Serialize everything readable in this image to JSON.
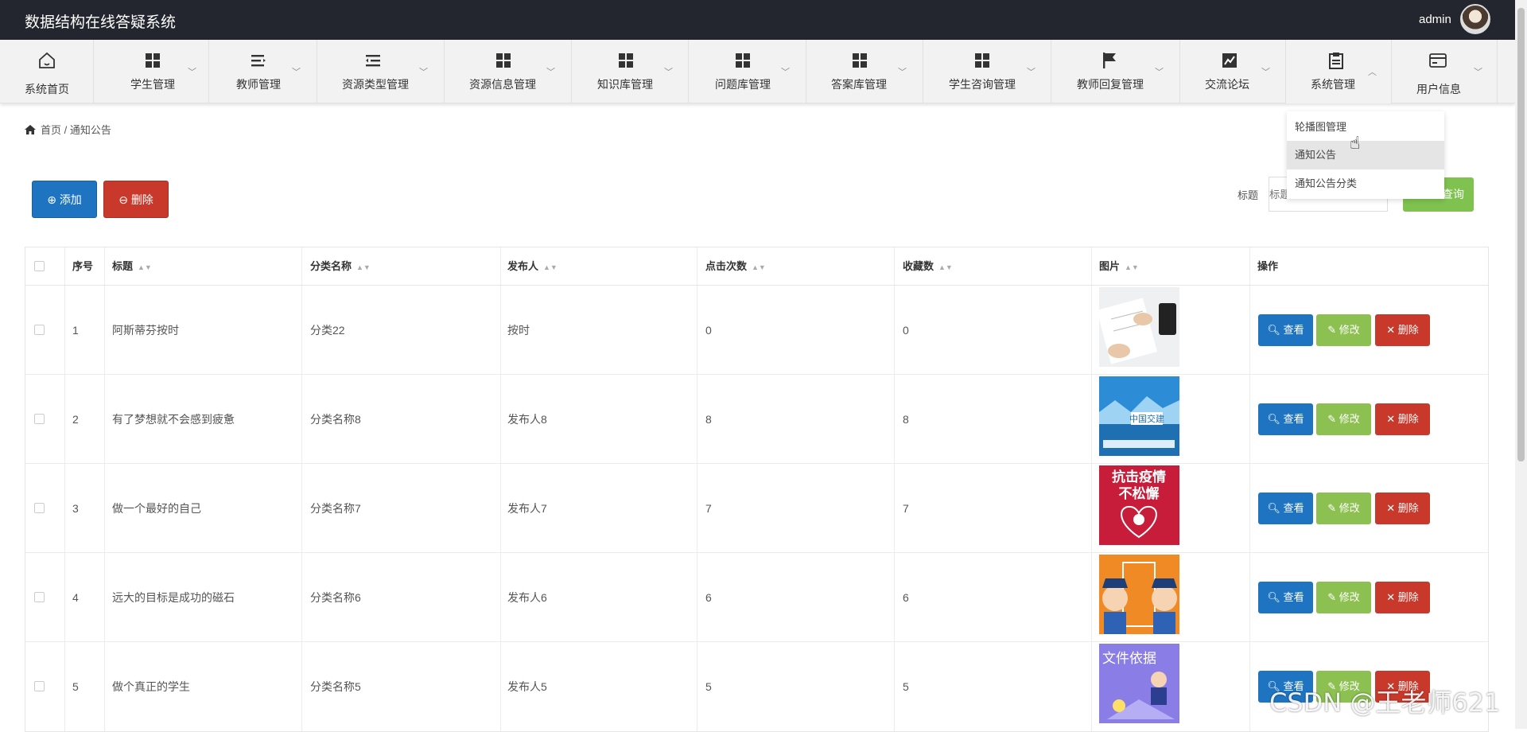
{
  "app": {
    "title": "数据结构在线答疑系统",
    "user": "admin"
  },
  "nav": [
    {
      "label": "系统首页",
      "icon": "home-icon"
    },
    {
      "label": "学生管理",
      "icon": "grid-icon"
    },
    {
      "label": "教师管理",
      "icon": "list-icon"
    },
    {
      "label": "资源类型管理",
      "icon": "indent-list-icon"
    },
    {
      "label": "资源信息管理",
      "icon": "grid-icon"
    },
    {
      "label": "知识库管理",
      "icon": "grid-icon"
    },
    {
      "label": "问题库管理",
      "icon": "grid-icon"
    },
    {
      "label": "答案库管理",
      "icon": "grid-icon"
    },
    {
      "label": "学生咨询管理",
      "icon": "grid-icon"
    },
    {
      "label": "教师回复管理",
      "icon": "flag-icon"
    },
    {
      "label": "交流论坛",
      "icon": "chart-icon"
    },
    {
      "label": "系统管理",
      "icon": "clipboard-icon"
    },
    {
      "label": "用户信息",
      "icon": "card-icon"
    }
  ],
  "dropdown": {
    "items": [
      "轮播图管理",
      "通知公告",
      "通知公告分类"
    ]
  },
  "breadcrumb": {
    "home": "首页",
    "separator": "/",
    "current": "通知公告"
  },
  "toolbar": {
    "add_label": "添加",
    "delete_label": "删除"
  },
  "search": {
    "label": "标题",
    "placeholder": "标题",
    "button": "查询"
  },
  "table": {
    "headers": [
      "序号",
      "标题",
      "分类名称",
      "发布人",
      "点击次数",
      "收藏数",
      "图片",
      "操作"
    ],
    "rows": [
      {
        "no": "1",
        "title": "阿斯蒂芬按时",
        "category": "分类22",
        "publisher": "按时",
        "clicks": "0",
        "favorites": "0",
        "image": "office-paperwork-photo"
      },
      {
        "no": "2",
        "title": "有了梦想就不会感到疲惫",
        "category": "分类名称8",
        "publisher": "发布人8",
        "clicks": "8",
        "favorites": "8",
        "image": "china-transport-poster"
      },
      {
        "no": "3",
        "title": "做一个最好的自己",
        "category": "分类名称7",
        "publisher": "发布人7",
        "clicks": "7",
        "favorites": "7",
        "image": "anti-epidemic-poster"
      },
      {
        "no": "4",
        "title": "远大的目标是成功的磁石",
        "category": "分类名称6",
        "publisher": "发布人6",
        "clicks": "6",
        "favorites": "6",
        "image": "police-cartoon"
      },
      {
        "no": "5",
        "title": "做个真正的学生",
        "category": "分类名称5",
        "publisher": "发布人5",
        "clicks": "5",
        "favorites": "5",
        "image": "document-basis-poster"
      }
    ],
    "actions": {
      "view": "查看",
      "edit": "修改",
      "delete": "删除"
    }
  },
  "poster_text": {
    "row2": "中国交建",
    "row3_line1": "抗击疫情",
    "row3_line2": "不松懈",
    "row5": "文件依据"
  },
  "watermark": "CSDN @王老师621",
  "colors": {
    "topbar": "#23262e",
    "primary": "#1e74c0",
    "danger": "#c8392b",
    "success": "#8cc152"
  }
}
